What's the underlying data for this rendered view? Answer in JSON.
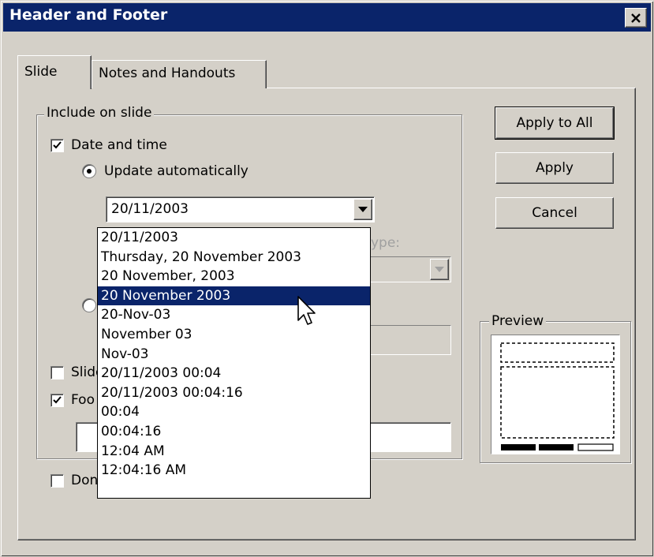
{
  "window": {
    "title": "Header and Footer"
  },
  "tabs": [
    {
      "label": "Slide",
      "active": true
    },
    {
      "label": "Notes and Handouts",
      "active": false
    }
  ],
  "include_group": {
    "label": "Include on slide",
    "date_and_time": {
      "label": "Date and time",
      "checked": true
    },
    "update_auto": {
      "label": "Update automatically",
      "selected": true
    },
    "date_value": "20/11/2003",
    "calendar_type_label": "ype:",
    "slide_number": {
      "label": "Slide",
      "checked": false
    },
    "footer": {
      "label": "Foo",
      "checked": true,
      "value": ""
    }
  },
  "dont_show": {
    "label": "Don",
    "checked": false
  },
  "dropdown_options": [
    "20/11/2003",
    "Thursday, 20 November 2003",
    "20 November, 2003",
    "20 November 2003",
    "20-Nov-03",
    "November 03",
    "Nov-03",
    "20/11/2003 00:04",
    "20/11/2003 00:04:16",
    "00:04",
    "00:04:16",
    "12:04 AM",
    "12:04:16 AM"
  ],
  "dropdown_selected_index": 3,
  "buttons": {
    "apply_all": "Apply to All",
    "apply": "Apply",
    "cancel": "Cancel"
  },
  "preview": {
    "label": "Preview"
  },
  "colors": {
    "titlebar": "#0a246a",
    "face": "#d4d0c8",
    "highlight": "#0a246a"
  }
}
